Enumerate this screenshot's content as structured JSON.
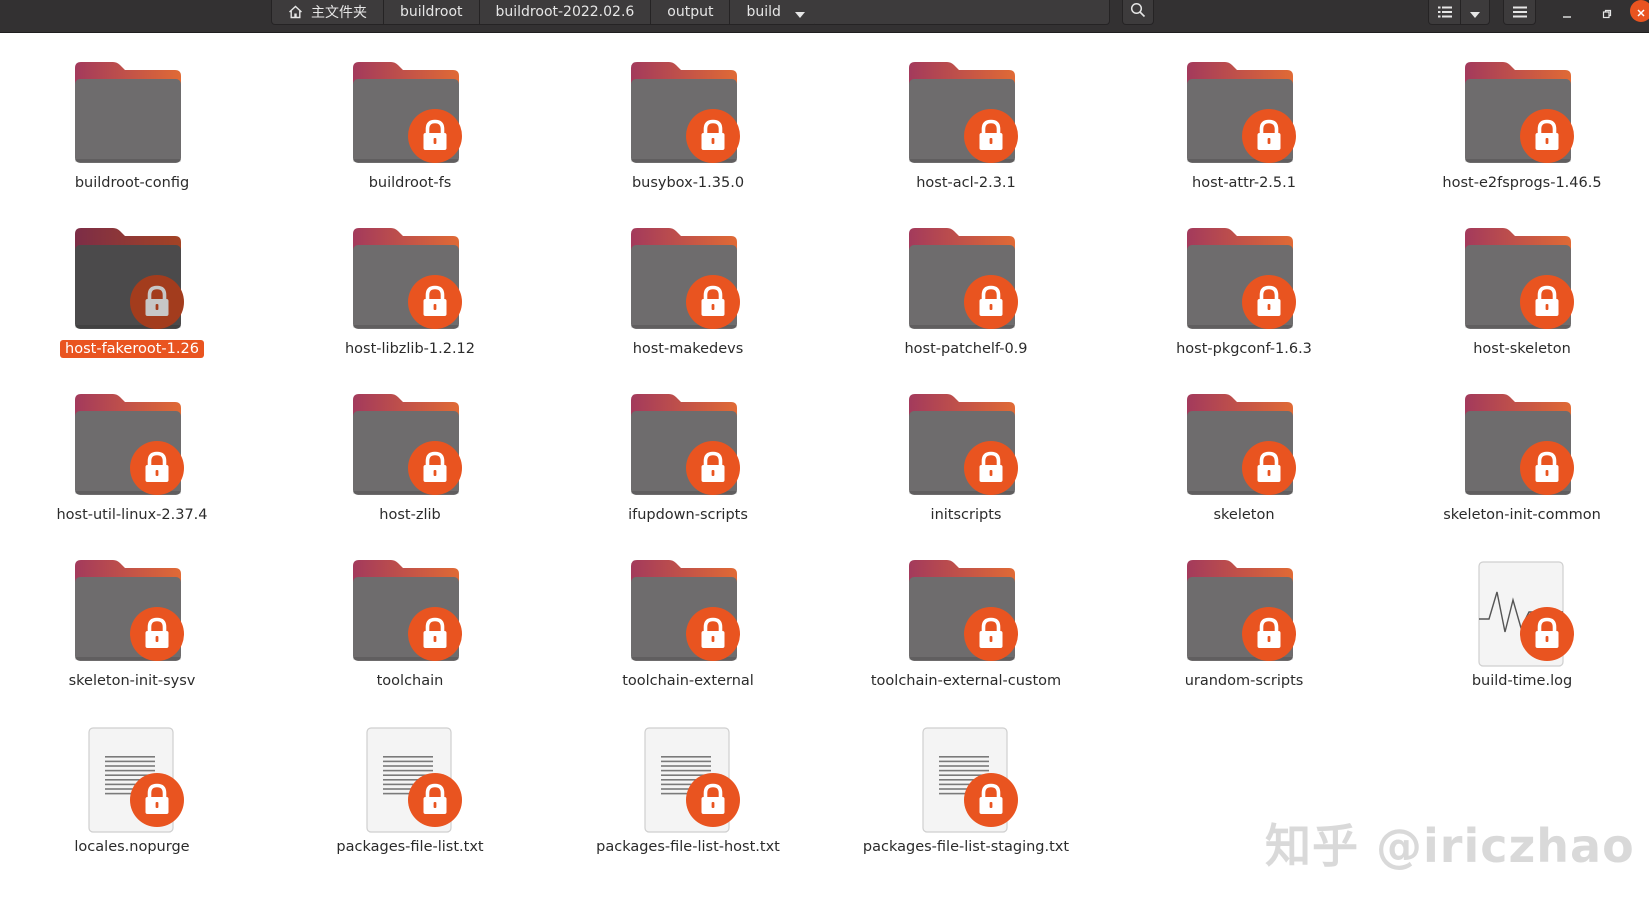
{
  "pathbar": {
    "home_label": "主文件夹",
    "crumbs": [
      "buildroot",
      "buildroot-2022.02.6",
      "output",
      "build"
    ]
  },
  "icons": {
    "home": "home-icon",
    "search": "search-icon",
    "view_toggle": "list-view-icon",
    "view_dropdown": "chevron-down-icon",
    "menu": "hamburger-menu-icon",
    "minimize": "minimize-icon",
    "restore": "restore-icon",
    "close": "close-icon",
    "folder": "folder-icon",
    "lock": "lock-icon",
    "text_file": "text-file-icon",
    "log_file": "log-file-icon"
  },
  "colors": {
    "accent": "#e95420",
    "folder_body": "#6e6c6d",
    "folder_tab": "#a33a5c",
    "header_bg": "#333132"
  },
  "files": [
    {
      "name": "buildroot-config",
      "kind": "folder",
      "locked": false,
      "selected": false
    },
    {
      "name": "buildroot-fs",
      "kind": "folder",
      "locked": true,
      "selected": false
    },
    {
      "name": "busybox-1.35.0",
      "kind": "folder",
      "locked": true,
      "selected": false
    },
    {
      "name": "host-acl-2.3.1",
      "kind": "folder",
      "locked": true,
      "selected": false
    },
    {
      "name": "host-attr-2.5.1",
      "kind": "folder",
      "locked": true,
      "selected": false
    },
    {
      "name": "host-e2fsprogs-1.46.5",
      "kind": "folder",
      "locked": true,
      "selected": false
    },
    {
      "name": "host-fakeroot-1.26",
      "kind": "folder",
      "locked": true,
      "selected": true
    },
    {
      "name": "host-libzlib-1.2.12",
      "kind": "folder",
      "locked": true,
      "selected": false
    },
    {
      "name": "host-makedevs",
      "kind": "folder",
      "locked": true,
      "selected": false
    },
    {
      "name": "host-patchelf-0.9",
      "kind": "folder",
      "locked": true,
      "selected": false
    },
    {
      "name": "host-pkgconf-1.6.3",
      "kind": "folder",
      "locked": true,
      "selected": false
    },
    {
      "name": "host-skeleton",
      "kind": "folder",
      "locked": true,
      "selected": false
    },
    {
      "name": "host-util-linux-2.37.4",
      "kind": "folder",
      "locked": true,
      "selected": false
    },
    {
      "name": "host-zlib",
      "kind": "folder",
      "locked": true,
      "selected": false
    },
    {
      "name": "ifupdown-scripts",
      "kind": "folder",
      "locked": true,
      "selected": false
    },
    {
      "name": "initscripts",
      "kind": "folder",
      "locked": true,
      "selected": false
    },
    {
      "name": "skeleton",
      "kind": "folder",
      "locked": true,
      "selected": false
    },
    {
      "name": "skeleton-init-common",
      "kind": "folder",
      "locked": true,
      "selected": false
    },
    {
      "name": "skeleton-init-sysv",
      "kind": "folder",
      "locked": true,
      "selected": false
    },
    {
      "name": "toolchain",
      "kind": "folder",
      "locked": true,
      "selected": false
    },
    {
      "name": "toolchain-external",
      "kind": "folder",
      "locked": true,
      "selected": false
    },
    {
      "name": "toolchain-external-custom",
      "kind": "folder",
      "locked": true,
      "selected": false
    },
    {
      "name": "urandom-scripts",
      "kind": "folder",
      "locked": true,
      "selected": false
    },
    {
      "name": "build-time.log",
      "kind": "log",
      "locked": true,
      "selected": false
    },
    {
      "name": "locales.nopurge",
      "kind": "text",
      "locked": true,
      "selected": false
    },
    {
      "name": "packages-file-list.txt",
      "kind": "text",
      "locked": true,
      "selected": false
    },
    {
      "name": "packages-file-list-host.txt",
      "kind": "text",
      "locked": true,
      "selected": false
    },
    {
      "name": "packages-file-list-staging.txt",
      "kind": "text",
      "locked": true,
      "selected": false
    }
  ],
  "watermark": "知乎 @iriczhao"
}
